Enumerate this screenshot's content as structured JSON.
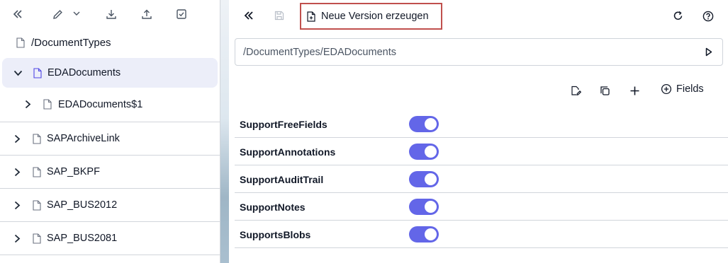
{
  "sidebar": {
    "root_path": "/DocumentTypes",
    "items": [
      {
        "label": "EDADocuments",
        "expanded": true,
        "selected": true
      },
      {
        "label": "EDADocuments$1",
        "expanded": false,
        "child": true
      },
      {
        "label": "SAPArchiveLink",
        "expanded": false
      },
      {
        "label": "SAP_BKPF",
        "expanded": false
      },
      {
        "label": "SAP_BUS2012",
        "expanded": false
      },
      {
        "label": "SAP_BUS2081",
        "expanded": false
      }
    ]
  },
  "main": {
    "new_version_label": "Neue Version erzeugen",
    "path_value": "/DocumentTypes/EDADocuments",
    "fields_label": "Fields",
    "properties": [
      {
        "label": "SupportFreeFields",
        "enabled": true
      },
      {
        "label": "SupportAnnotations",
        "enabled": true
      },
      {
        "label": "SupportAuditTrail",
        "enabled": true
      },
      {
        "label": "SupportNotes",
        "enabled": true
      },
      {
        "label": "SupportsBlobs",
        "enabled": true
      }
    ]
  },
  "colors": {
    "toggle_on": "#6366e8",
    "highlight_border": "#c0504d",
    "selected_row": "#eceef9"
  }
}
